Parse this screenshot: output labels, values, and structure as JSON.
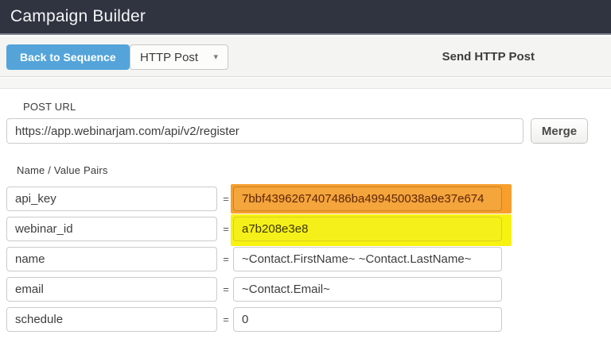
{
  "header": {
    "title": "Campaign Builder"
  },
  "toolbar": {
    "back_button_label": "Back to Sequence",
    "dropdown_value": "HTTP Post",
    "section_title": "Send HTTP Post"
  },
  "icons": {
    "dropdown_caret": "▾"
  },
  "post_url": {
    "label": "POST URL",
    "value": "https://app.webinarjam.com/api/v2/register",
    "merge_button_label": "Merge"
  },
  "pairs": {
    "label": "Name / Value Pairs",
    "equals_sign": "=",
    "rows": [
      {
        "name": "api_key",
        "value": "7bbf4396267407486ba499450038a9e37e674",
        "highlight": "orange"
      },
      {
        "name": "webinar_id",
        "value": "a7b208e3e8",
        "highlight": "yellow"
      },
      {
        "name": "name",
        "value": "~Contact.FirstName~ ~Contact.LastName~",
        "highlight": "none"
      },
      {
        "name": "email",
        "value": "~Contact.Email~",
        "highlight": "none"
      },
      {
        "name": "schedule",
        "value": "0",
        "highlight": "none"
      }
    ]
  },
  "colors": {
    "header_bg": "#2F3440",
    "toolbar_bg": "#F4F4F2",
    "accent_blue": "#54A4DA",
    "highlight_orange": "#F79E2D",
    "highlight_yellow": "#F8F211"
  }
}
